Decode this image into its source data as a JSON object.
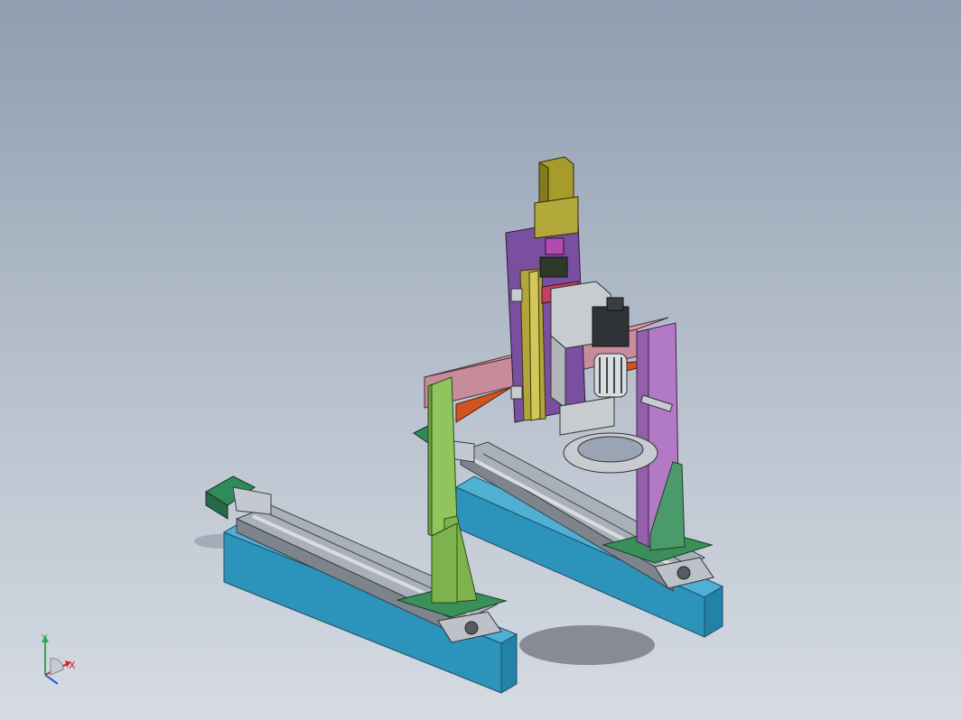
{
  "colors": {
    "base_blue": "#2c93bb",
    "rail_gray": "#9aa1a8",
    "column_green": "#7db34a",
    "foot_green": "#3a8f5a",
    "plate_purple": "#7a4fa0",
    "beam_pink": "#c78c9c",
    "motor_olive": "#a79b2b",
    "bracket_gray": "#c8cbd0",
    "orange_gusset": "#d1541e",
    "right_plate_violet": "#b27ac6"
  },
  "triad": {
    "x_label": "X",
    "y_label": "Y",
    "x_color": "#d2232a",
    "y_color": "#33a853",
    "z_color": "#2f5bd8"
  }
}
